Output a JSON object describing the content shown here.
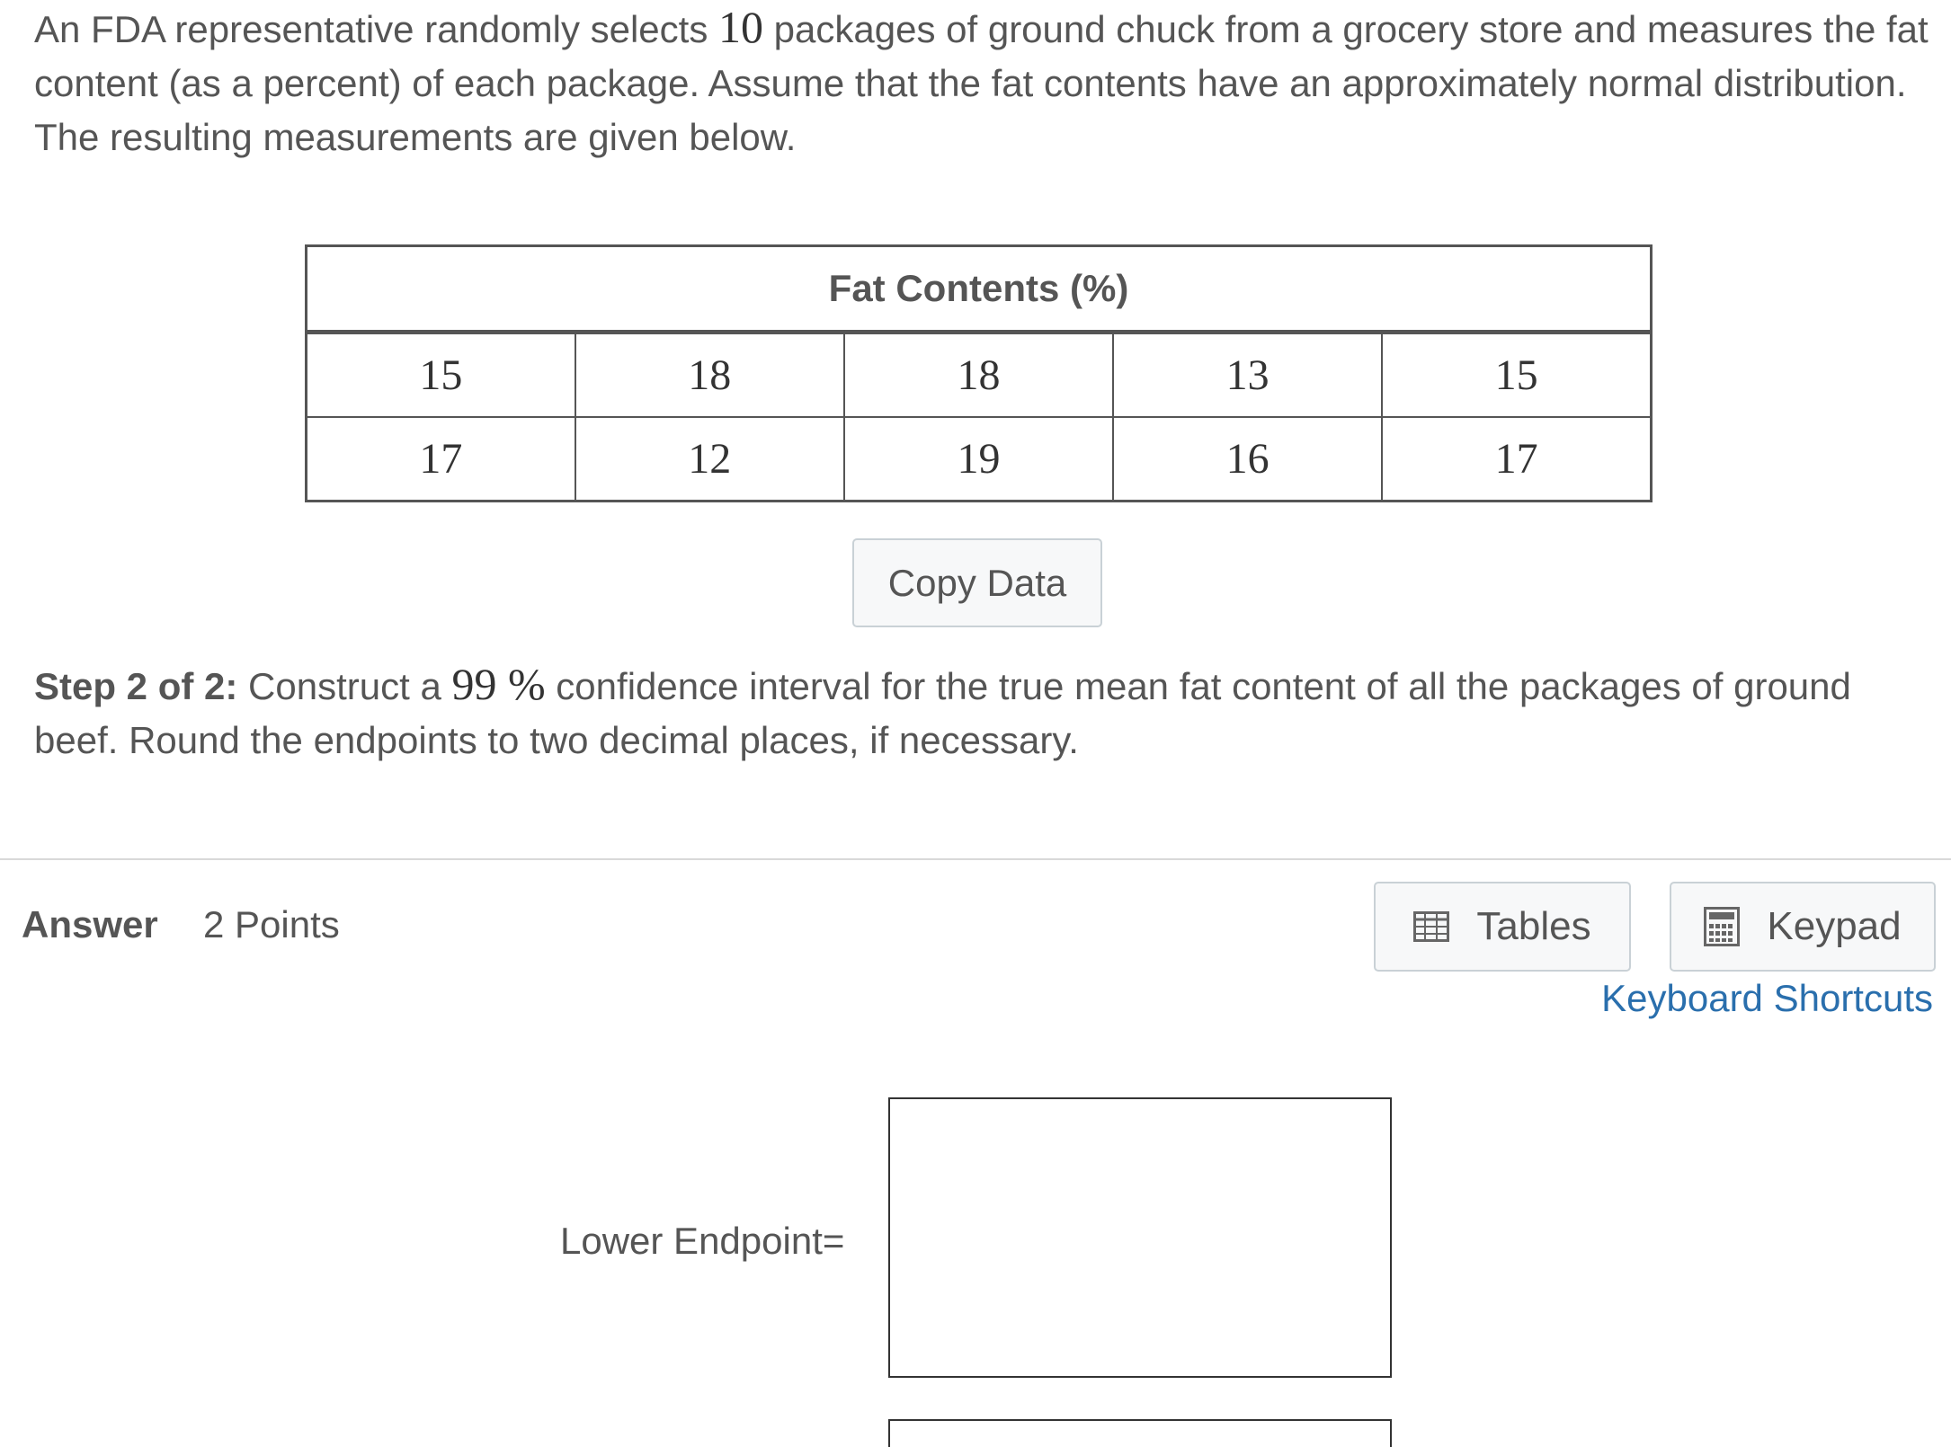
{
  "question": {
    "text_before": "An FDA representative randomly selects ",
    "sample_size": "10",
    "text_after": " packages of ground chuck from a grocery store and measures the fat content (as a percent) of each package. Assume that the fat contents have an approximately normal distribution. The resulting measurements are given below."
  },
  "table": {
    "header": "Fat Contents (%)",
    "rows": [
      [
        "15",
        "18",
        "18",
        "13",
        "15"
      ],
      [
        "17",
        "12",
        "19",
        "16",
        "17"
      ]
    ]
  },
  "copy_button": "Copy Data",
  "step": {
    "label": "Step 2 of 2:",
    "text_before": " Construct a ",
    "confidence": "99 %",
    "text_after": " confidence interval for the true mean fat content of all the packages of ground beef. Round the endpoints to two decimal places, if necessary."
  },
  "answer": {
    "label": "Answer",
    "points": "2 Points"
  },
  "tools": {
    "tables_label": "Tables",
    "keypad_label": "Keypad",
    "shortcuts_label": "Keyboard Shortcuts"
  },
  "inputs": {
    "lower_label": "Lower Endpoint=",
    "lower_value": "",
    "upper_value": ""
  },
  "colors": {
    "text": "#555555",
    "link": "#2a6fad",
    "button_bg": "#f7f8f9",
    "button_border": "#c9d1d6"
  },
  "icons": {
    "tables": "table-grid-icon",
    "keypad": "calculator-icon"
  }
}
